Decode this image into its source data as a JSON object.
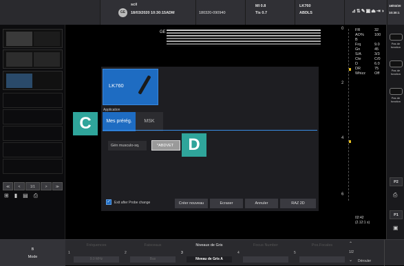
{
  "header": {
    "logo": "GE",
    "site": "scil",
    "datetime": "18/03/2020 10:30:15ADM",
    "id": "180320-090940",
    "mi": "MI 0.8",
    "tis": "Tis 0.7",
    "probe": "LK760",
    "preset": "ABDLS",
    "clock_date": "18/03/20",
    "clock_time": "10:30:1"
  },
  "image": {
    "ge_label": "GE"
  },
  "dialog": {
    "probe_name": "LK760",
    "application_label": "Application",
    "tabs": [
      "Mes prérég.",
      "MSK"
    ],
    "preset_label": "Gén musculo-sq.",
    "preset_value": "*ABDVET",
    "checkbox_label": "Exit after Probe change",
    "buttons": [
      "Créer nouveau",
      "Ecraser",
      "Annuler",
      "RAZ 2D"
    ]
  },
  "callouts": {
    "c": "C",
    "d": "D"
  },
  "depth_scale": [
    "0",
    "2",
    "4",
    "6"
  ],
  "params": [
    {
      "name": "FR",
      "value": "32"
    },
    {
      "name": "AO%",
      "value": "100"
    },
    {
      "name": "B",
      "value": ""
    },
    {
      "name": "Frq",
      "value": "9.0"
    },
    {
      "name": "Gn",
      "value": "45"
    },
    {
      "name": "S/A",
      "value": "3/3"
    },
    {
      "name": "Cte",
      "value": "C/0"
    },
    {
      "name": "D",
      "value": "6.0"
    },
    {
      "name": "DR",
      "value": "75"
    },
    {
      "name": "Whizz",
      "value": "Off"
    }
  ],
  "cine": {
    "time": "02:42",
    "duration": "(2.12:1 s)"
  },
  "right_panel": {
    "texts": [
      "Pas de fonction",
      "Pas de fonction",
      "Pas de fonction"
    ],
    "keys": [
      "P2",
      "P1"
    ]
  },
  "left_panel": {
    "nav": [
      "≪",
      "<",
      "1/1",
      ">",
      "≫"
    ]
  },
  "footer": {
    "mode_top": "B",
    "mode_bottom": "Mode",
    "controls": [
      {
        "num": "1",
        "label": "Fréquences",
        "value": "9.0 MHz",
        "active": false
      },
      {
        "num": "2",
        "label": "Faisceaux",
        "value": "Bas",
        "active": false
      },
      {
        "num": "3",
        "label": "Niveaux de Gris",
        "value": "Niveau de Gris A",
        "active": true
      },
      {
        "num": "4",
        "label": "Focus Number",
        "value": "",
        "active": false
      },
      {
        "num": "5",
        "label": "Pos.Focales",
        "value": "",
        "active": false
      }
    ],
    "page": "1/2",
    "right_label": "Dérouler"
  },
  "colors": {
    "accent_blue": "#1e6cc2",
    "callout": "#2fa59b",
    "active_tab_underline": "#3b8fe8"
  }
}
